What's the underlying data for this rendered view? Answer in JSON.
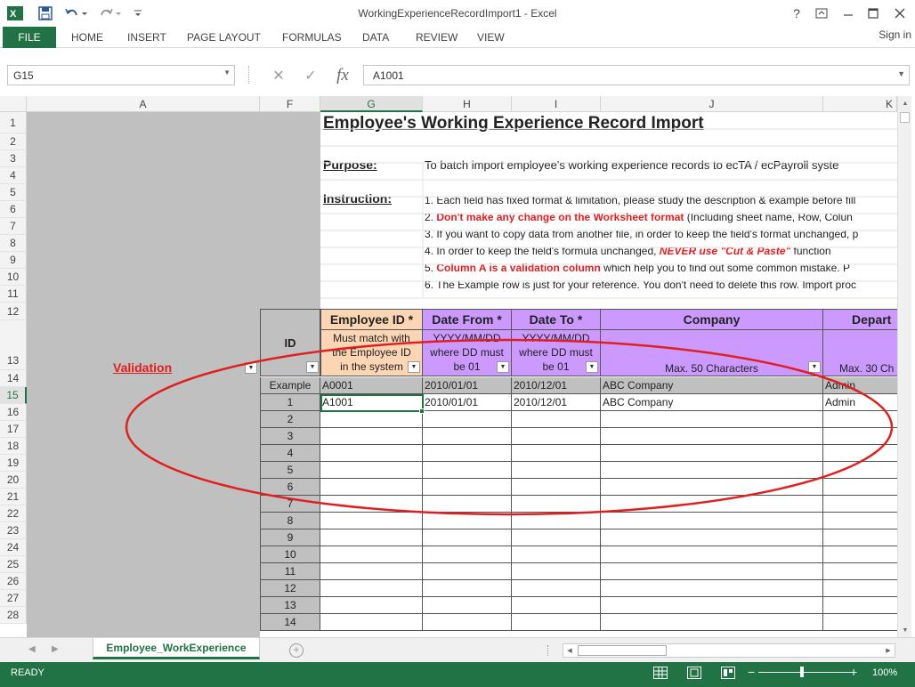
{
  "window": {
    "title": "WorkingExperienceRecordImport1 - Excel",
    "controls": [
      "?",
      "restore-ribbon",
      "minimize",
      "maximize",
      "close"
    ]
  },
  "ribbon": {
    "tabs": [
      "FILE",
      "HOME",
      "INSERT",
      "PAGE LAYOUT",
      "FORMULAS",
      "DATA",
      "REVIEW",
      "VIEW"
    ],
    "sign_in": "Sign in"
  },
  "formula_bar": {
    "name_box": "G15",
    "fx": "fx",
    "value": "A1001"
  },
  "columns": [
    "A",
    "F",
    "G",
    "H",
    "I",
    "J",
    "K"
  ],
  "selected_column": "G",
  "selected_row": "15",
  "rows": [
    "1",
    "2",
    "3",
    "4",
    "5",
    "6",
    "7",
    "8",
    "9",
    "10",
    "11",
    "12",
    "13",
    "14",
    "15",
    "16",
    "17",
    "18",
    "19",
    "20",
    "21",
    "22",
    "23",
    "24",
    "25",
    "26",
    "27",
    "28"
  ],
  "sheet": {
    "title": "Employee's Working Experience Record Import",
    "purpose_label": "Purpose:",
    "purpose_text": "To batch import employee's working experience records to ecTA / ecPayroll syste",
    "instruction_label": "Instruction:",
    "instructions": [
      {
        "plain": "1. Each field has fixed format & limitation, please study the description & example before fill",
        "red": "",
        "tail": ""
      },
      {
        "plain": "2. ",
        "red": "Don't make any change on the Worksheet format",
        "tail": " (Including sheet name, Row, Colun"
      },
      {
        "plain": "3. If you want to copy data from another file, in order to keep the field's format unchanged, p",
        "red": "",
        "tail": ""
      },
      {
        "plain": "4. In order to keep the field's formula unchanged, ",
        "red": "NEVER use \"Cut & Paste\"",
        "tail": " function"
      },
      {
        "plain": "5. ",
        "red": "Column A is a validation column",
        "tail": " which help you to find out some common mistake. P"
      },
      {
        "plain": "6. The Example row is just for your reference. You don't need to delete this row. Import proc",
        "red": "",
        "tail": ""
      }
    ],
    "validation_label": "Validation",
    "id_header": "ID",
    "headers": {
      "employee_id": {
        "title": "Employee ID",
        "star": "*",
        "desc": [
          "Must match with",
          "the Employee ID",
          "in the system"
        ]
      },
      "date_from": {
        "title": "Date From",
        "star": "*",
        "desc": [
          "YYYY/MM/DD",
          "where DD must",
          "be 01"
        ]
      },
      "date_to": {
        "title": "Date To",
        "star": "*",
        "desc": [
          "YYYY/MM/DD",
          "where DD must",
          "be 01"
        ]
      },
      "company": {
        "title": "Company",
        "desc": [
          "Max. 50 Characters"
        ]
      },
      "department": {
        "title": "Depart",
        "desc": [
          "Max. 30 Ch"
        ]
      }
    },
    "example_row": {
      "id": "Example",
      "employee_id": "A0001",
      "date_from": "2010/01/01",
      "date_to": "2010/12/01",
      "company": "ABC Company",
      "department": "Admin"
    },
    "data_rows": [
      {
        "id": "1",
        "employee_id": "A1001",
        "date_from": "2010/01/01",
        "date_to": "2010/12/01",
        "company": "ABC Company",
        "department": "Admin"
      },
      {
        "id": "2"
      },
      {
        "id": "3"
      },
      {
        "id": "4"
      },
      {
        "id": "5"
      },
      {
        "id": "6"
      },
      {
        "id": "7"
      },
      {
        "id": "8"
      },
      {
        "id": "9"
      },
      {
        "id": "10"
      },
      {
        "id": "11"
      },
      {
        "id": "12"
      },
      {
        "id": "13"
      },
      {
        "id": "14"
      }
    ]
  },
  "sheet_tabs": {
    "active": "Employee_WorkExperience"
  },
  "status": {
    "text": "READY",
    "zoom": "100%"
  },
  "colors": {
    "excel_green": "#217346",
    "annotation_red": "#e02020",
    "employee_id_header": "#fcd5b4",
    "other_header": "#cc99ff"
  }
}
